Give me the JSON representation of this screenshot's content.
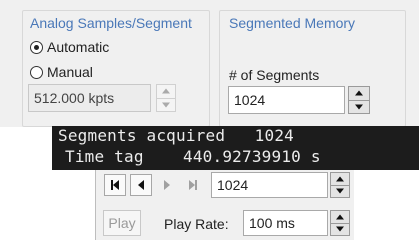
{
  "analog_group": {
    "title": "Analog Samples/Segment",
    "options": [
      {
        "label": "Automatic",
        "selected": true
      },
      {
        "label": "Manual",
        "selected": false
      }
    ],
    "samples_value": "512.000 kpts"
  },
  "segmented_group": {
    "title": "Segmented Memory",
    "segments_label": "# of Segments",
    "segments_value": "1024"
  },
  "status": {
    "segments_acquired_label": "Segments acquired",
    "segments_acquired_value": "1024",
    "time_tag_label": "Time tag",
    "time_tag_value": "440.92739910 s"
  },
  "playback": {
    "current_segment": "1024",
    "play_label": "Play",
    "play_rate_label": "Play Rate:",
    "play_rate_value": "100 ms",
    "icons": [
      "first-segment-icon",
      "previous-segment-icon",
      "next-segment-icon",
      "last-segment-icon"
    ]
  }
}
